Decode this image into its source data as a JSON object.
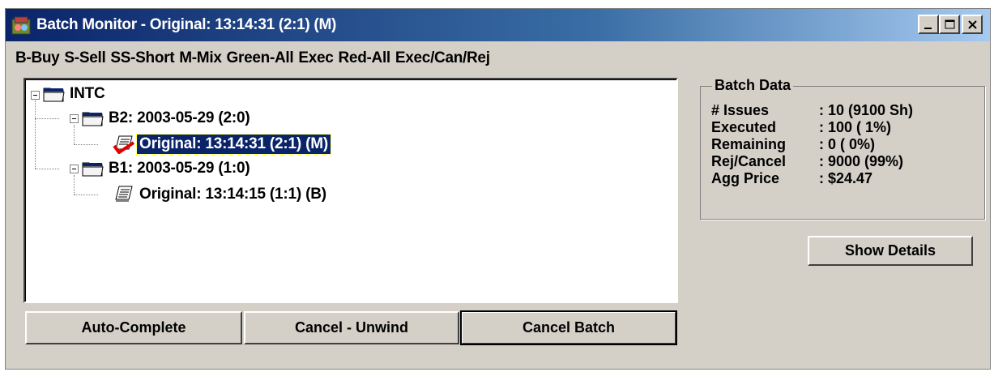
{
  "window": {
    "title": "Batch Monitor - Original: 13:14:31 (2:1) (M)",
    "app_icon": "batch-monitor-app-icon",
    "controls": [
      "minimize-icon",
      "maximize-icon",
      "close-icon"
    ]
  },
  "legend": {
    "text": "B-Buy  S-Sell  SS-Short  M-Mix    Green-All Exec  Red-All Exec/Can/Rej"
  },
  "tree": {
    "root": {
      "label": "INTC",
      "icon": "folder-open-icon"
    },
    "batch2": {
      "label": "B2: 2003-05-29 (2:0)",
      "icon": "folder-open-icon"
    },
    "batch2_order": {
      "label": "Original: 13:14:31 (2:1) (M)",
      "icon": "order-document-red-icon",
      "selected": true
    },
    "batch1": {
      "label": "B1: 2003-05-29 (1:0)",
      "icon": "folder-open-icon"
    },
    "batch1_order": {
      "label": "Original: 13:14:15 (1:1) (B)",
      "icon": "order-document-icon"
    }
  },
  "batch_data": {
    "title": "Batch Data",
    "rows": [
      {
        "label": "# Issues",
        "value": ": 10 (9100 Sh)"
      },
      {
        "label": "Executed",
        "value": ": 100 ( 1%)"
      },
      {
        "label": "Remaining",
        "value": ": 0 ( 0%)"
      },
      {
        "label": "Rej/Cancel",
        "value": ": 9000 (99%)"
      },
      {
        "label": "Agg Price",
        "value": ": $24.47"
      }
    ]
  },
  "buttons": {
    "show_details": "Show Details",
    "auto_complete": "Auto-Complete",
    "cancel_unwind": "Cancel - Unwind",
    "cancel_batch": "Cancel Batch"
  },
  "colors": {
    "title_gradient_start": "#0a246a",
    "title_gradient_end": "#a6caf0",
    "face": "#d4d0c8",
    "selection": "#0a246a",
    "order_status_red": "#e00000"
  }
}
